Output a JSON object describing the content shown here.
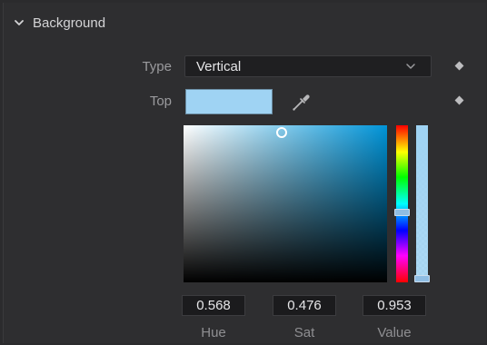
{
  "section": {
    "title": "Background",
    "chevron_icon": "chevron-down-icon"
  },
  "type_row": {
    "label": "Type",
    "value": "Vertical",
    "dropdown_icon": "chevron-down-icon",
    "keyframe_icon": "diamond-icon"
  },
  "top_row": {
    "label": "Top",
    "swatch_color": "#9fd3f3",
    "picker_icon": "eyedropper-icon",
    "keyframe_icon": "diamond-icon"
  },
  "color_picker": {
    "sv_base_color": "#0094d8",
    "handles_color": "#8fbde3"
  },
  "fields": {
    "hue_value": "0.568",
    "sat_value": "0.476",
    "value_value": "0.953",
    "hue_label": "Hue",
    "sat_label": "Sat",
    "value_label": "Value"
  }
}
